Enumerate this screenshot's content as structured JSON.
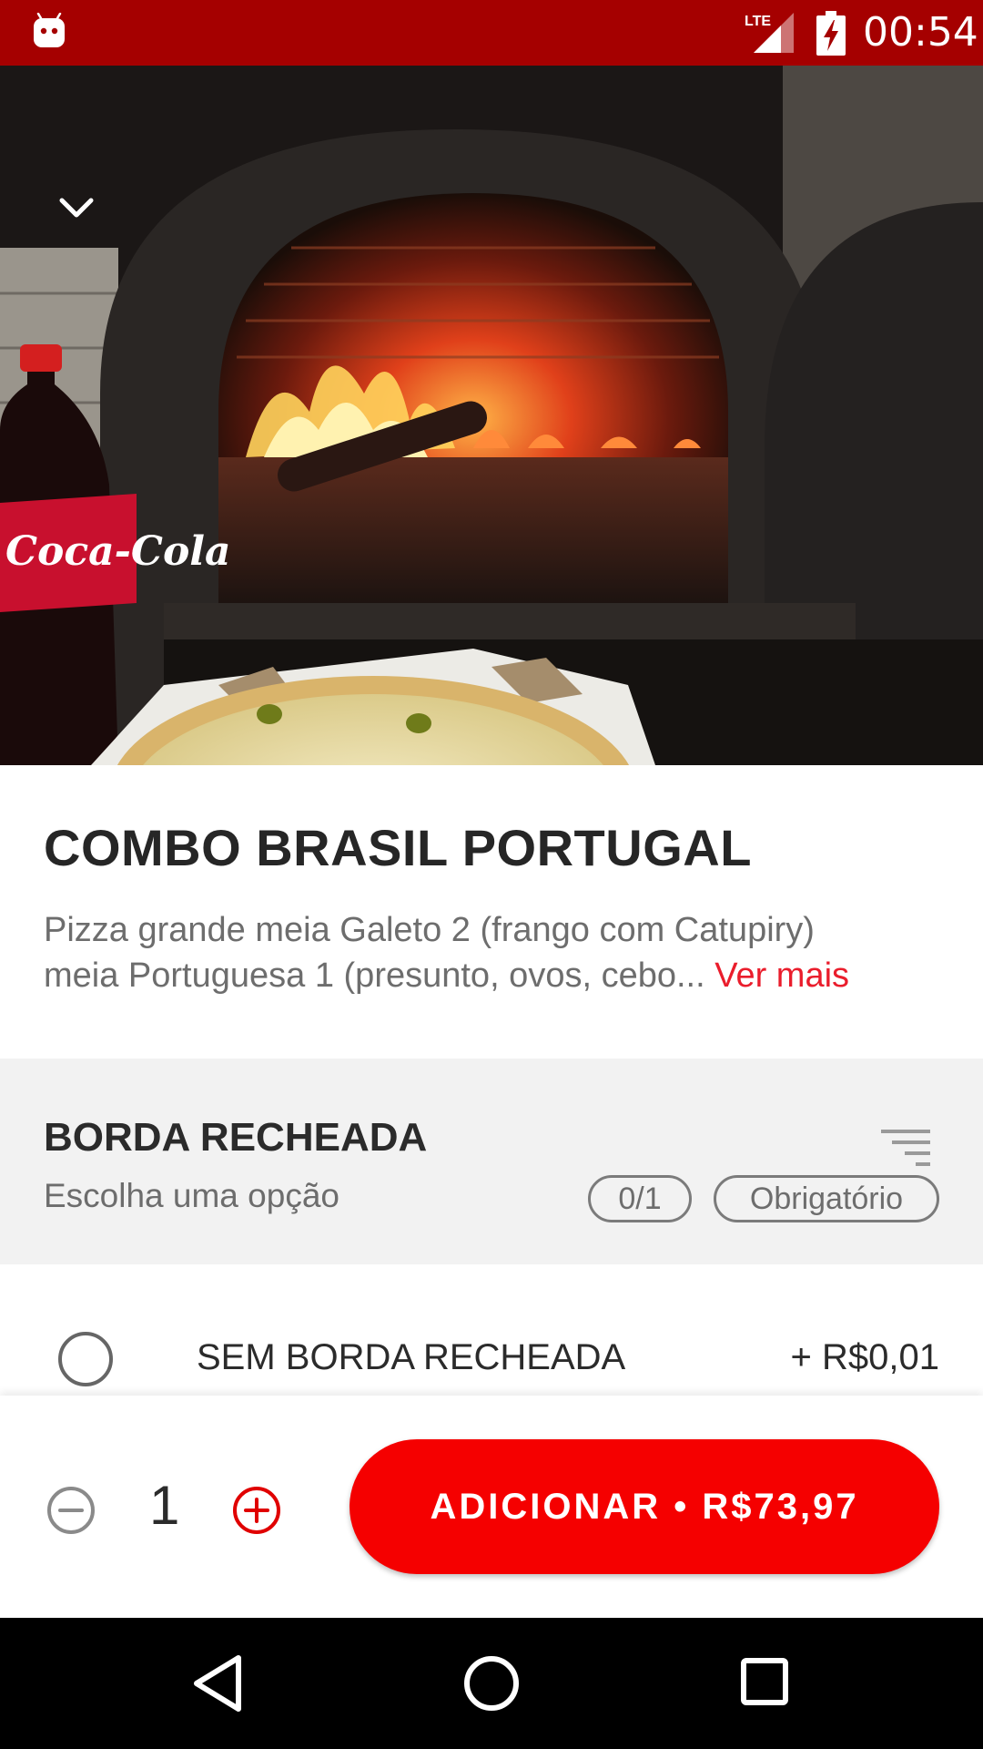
{
  "status_bar": {
    "time": "00:54",
    "network": "LTE",
    "icons": [
      "android-icon",
      "lte-signal-icon",
      "battery-charging-icon"
    ]
  },
  "hero": {
    "collapse_icon": "chevron-down-icon"
  },
  "product": {
    "title": "COMBO BRASIL PORTUGAL",
    "description_line1": "Pizza grande meia Galeto 2 (frango com Catupiry)",
    "description_line2": "meia Portuguesa 1 (presunto, ovos, cebo...",
    "see_more": "Ver mais"
  },
  "option_group": {
    "title": "BORDA RECHEADA",
    "subtitle": "Escolha uma opção",
    "count": "0/1",
    "required": "Obrigatório",
    "options": [
      {
        "label": "SEM BORDA RECHEADA",
        "price": "+ R$0,01",
        "selected": false
      }
    ]
  },
  "cart": {
    "quantity": "1",
    "add_label": "ADICIONAR • R$73,97"
  },
  "colors": {
    "status_bar": "#a50000",
    "accent": "#f50000",
    "link": "#ea1d2c",
    "section_bg": "#f2f2f2",
    "nav_bar": "#000000"
  },
  "nav_bar": {
    "icons": [
      "back-icon",
      "home-icon",
      "recent-apps-icon"
    ]
  }
}
